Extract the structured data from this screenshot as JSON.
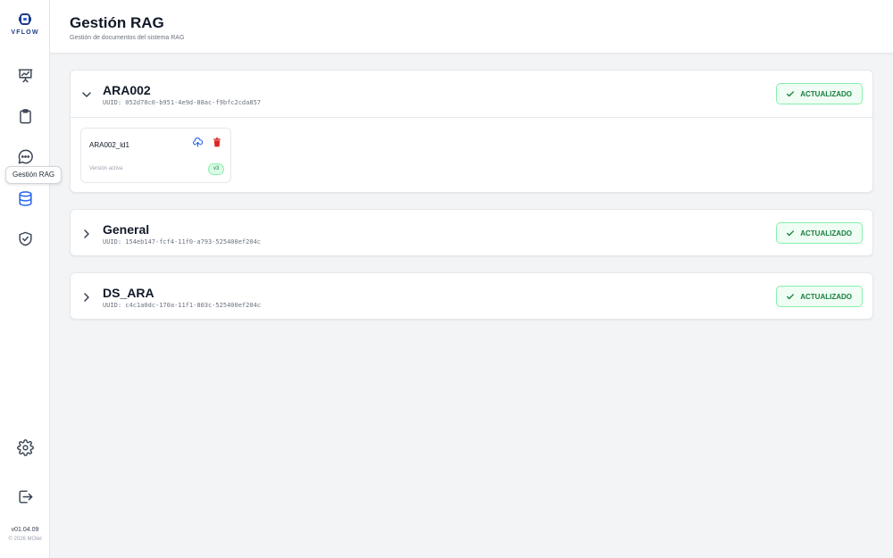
{
  "app": {
    "logo_text": "VFLOW",
    "version": "v01.04.09",
    "copyright": "© 2026 MOtel"
  },
  "sidebar": {
    "items": [
      {
        "name": "presentation-chart-icon"
      },
      {
        "name": "clipboard-icon"
      },
      {
        "name": "chat-icon"
      },
      {
        "name": "database-icon",
        "active": true
      },
      {
        "name": "shield-check-icon"
      }
    ],
    "tooltip": "Gestión RAG",
    "settings_icon": "gear-icon",
    "logout_icon": "logout-icon"
  },
  "header": {
    "title": "Gestión RAG",
    "subtitle": "Gestión de documentos del sistema RAG"
  },
  "groups": [
    {
      "name": "ARA002",
      "uuid": "UUID: 052d70c0-b951-4e9d-88ac-f9bfc2cda857",
      "status": "ACTUALIZADO",
      "expanded": true,
      "documents": [
        {
          "name": "ARA002_ld1",
          "status": "Versión activa",
          "version": "v3"
        }
      ]
    },
    {
      "name": "General",
      "uuid": "UUID: 154eb147-fcf4-11f0-a793-525400ef204c",
      "status": "ACTUALIZADO",
      "expanded": false
    },
    {
      "name": "DS_ARA",
      "uuid": "UUID: c4c1a0dc-170a-11f1-803c-525400ef204c",
      "status": "ACTUALIZADO",
      "expanded": false
    }
  ],
  "colors": {
    "brand": "#1e3a8a",
    "accent": "#2563eb",
    "success": "#15803d",
    "success_bg": "#f0fdf4",
    "danger": "#dc2626"
  }
}
